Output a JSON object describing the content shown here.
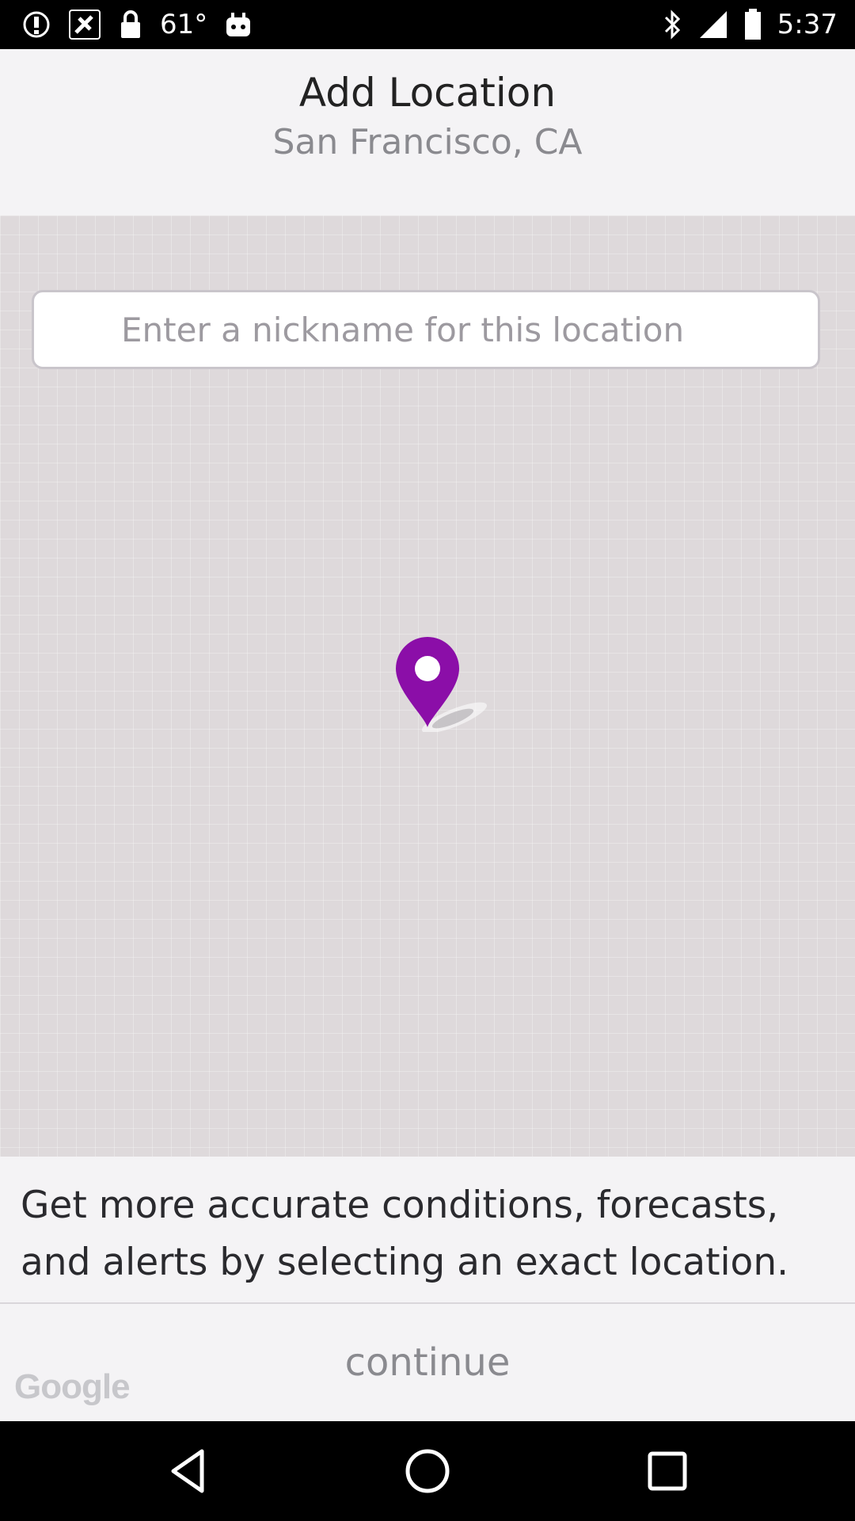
{
  "status_bar": {
    "temperature": "61°",
    "time": "5:37",
    "icons": [
      "alert-icon",
      "fake-gps-icon",
      "lock-icon",
      "weather-app-icon",
      "bluetooth-icon",
      "signal-icon",
      "battery-icon"
    ]
  },
  "header": {
    "title": "Add Location",
    "subtitle": "San Francisco, CA"
  },
  "map": {
    "nickname_placeholder": "Enter a nickname for this location",
    "nickname_value": "",
    "pin_icon": "location-pin-icon",
    "pin_color": "#8b0ea8"
  },
  "info": {
    "text": "Get more accurate conditions, forecasts, and alerts by selecting an exact location."
  },
  "footer": {
    "continue_label": "continue",
    "google_logo": "Google"
  },
  "nav_bar": {
    "icons": [
      "back-icon",
      "home-icon",
      "recents-icon"
    ]
  }
}
